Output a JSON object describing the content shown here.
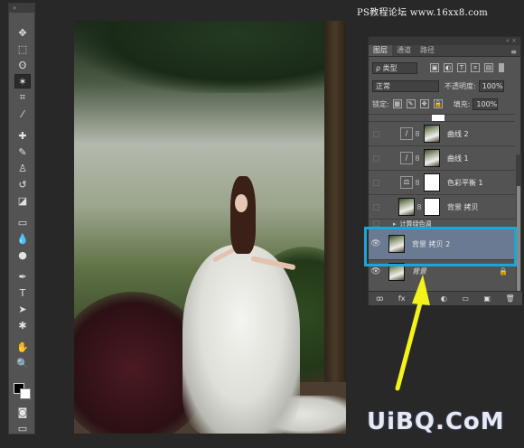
{
  "watermark_site": "PS教程论坛 www.16xx8.com",
  "watermark_brand": "UiBQ.CoM",
  "toolbar": {
    "collapse_glyph": "»",
    "tools": [
      "move-icon",
      "marquee-icon",
      "lasso-icon",
      "magic-wand-icon",
      "crop-icon",
      "eyedropper-icon",
      "healing-brush-icon",
      "brush-icon",
      "clone-stamp-icon",
      "history-brush-icon",
      "eraser-icon",
      "gradient-icon",
      "blur-icon",
      "dodge-icon",
      "pen-icon",
      "type-icon",
      "path-selection-icon",
      "shape-icon",
      "hand-icon",
      "zoom-icon"
    ],
    "foreground_color": "#000000",
    "background_color": "#ffffff"
  },
  "panel": {
    "header_glyph": "« ×",
    "tabs": [
      "图层",
      "通道",
      "路径"
    ],
    "filter_label": "ρ 类型",
    "blend_mode": "正常",
    "opacity_label": "不透明度:",
    "opacity_value": "100%",
    "lock_label": "锁定:",
    "fill_label": "填充:",
    "fill_value": "100%",
    "layers": [
      {
        "name": "曲线 2",
        "kind": "curves",
        "visible": false
      },
      {
        "name": "曲线 1",
        "kind": "curves",
        "visible": false
      },
      {
        "name": "色彩平衡 1",
        "kind": "color-balance",
        "visible": false
      },
      {
        "name": "背景 拷贝",
        "kind": "photo-mask",
        "visible": false
      },
      {
        "name": "计算绿色调",
        "kind": "group",
        "visible": false
      },
      {
        "name": "背景 拷贝 2",
        "kind": "photo",
        "visible": true,
        "selected": true
      },
      {
        "name": "背景",
        "kind": "photo",
        "visible": true,
        "locked": true
      }
    ],
    "bottom_icons": [
      "link-icon",
      "fx-icon",
      "mask-icon",
      "adjustment-icon",
      "folder-icon",
      "new-layer-icon",
      "trash-icon"
    ],
    "bottom_glyphs": [
      "ꝏ",
      "fx",
      "◘",
      "◐",
      "▭",
      "▣",
      "🗑"
    ]
  },
  "colors": {
    "highlight": "#1aa6d7",
    "arrow": "#f4f21c"
  }
}
